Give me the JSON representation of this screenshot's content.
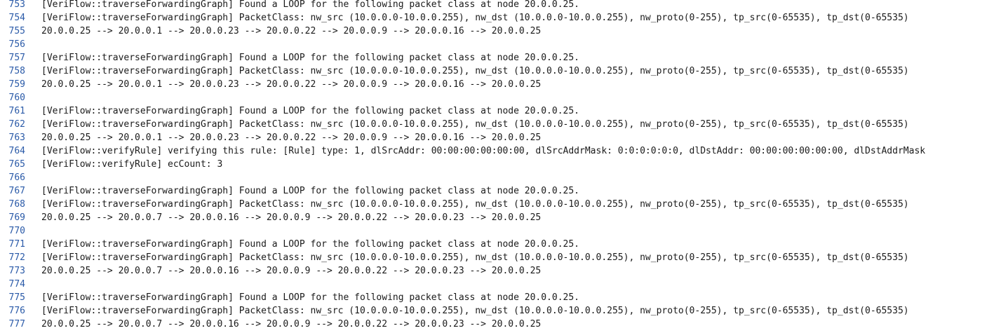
{
  "editor": {
    "lines": [
      {
        "num": "753",
        "text": "[VeriFlow::traverseForwardingGraph] Found a LOOP for the following packet class at node 20.0.0.25."
      },
      {
        "num": "754",
        "text": "[VeriFlow::traverseForwardingGraph] PacketClass: nw_src (10.0.0.0-10.0.0.255), nw_dst (10.0.0.0-10.0.0.255), nw_proto(0-255), tp_src(0-65535), tp_dst(0-65535)"
      },
      {
        "num": "755",
        "text": "20.0.0.25 --> 20.0.0.1 --> 20.0.0.23 --> 20.0.0.22 --> 20.0.0.9 --> 20.0.0.16 --> 20.0.0.25"
      },
      {
        "num": "756",
        "text": ""
      },
      {
        "num": "757",
        "text": "[VeriFlow::traverseForwardingGraph] Found a LOOP for the following packet class at node 20.0.0.25."
      },
      {
        "num": "758",
        "text": "[VeriFlow::traverseForwardingGraph] PacketClass: nw_src (10.0.0.0-10.0.0.255), nw_dst (10.0.0.0-10.0.0.255), nw_proto(0-255), tp_src(0-65535), tp_dst(0-65535)"
      },
      {
        "num": "759",
        "text": "20.0.0.25 --> 20.0.0.1 --> 20.0.0.23 --> 20.0.0.22 --> 20.0.0.9 --> 20.0.0.16 --> 20.0.0.25"
      },
      {
        "num": "760",
        "text": ""
      },
      {
        "num": "761",
        "text": "[VeriFlow::traverseForwardingGraph] Found a LOOP for the following packet class at node 20.0.0.25."
      },
      {
        "num": "762",
        "text": "[VeriFlow::traverseForwardingGraph] PacketClass: nw_src (10.0.0.0-10.0.0.255), nw_dst (10.0.0.0-10.0.0.255), nw_proto(0-255), tp_src(0-65535), tp_dst(0-65535)"
      },
      {
        "num": "763",
        "text": "20.0.0.25 --> 20.0.0.1 --> 20.0.0.23 --> 20.0.0.22 --> 20.0.0.9 --> 20.0.0.16 --> 20.0.0.25"
      },
      {
        "num": "764",
        "text": "[VeriFlow::verifyRule] verifying this rule: [Rule] type: 1, dlSrcAddr: 00:00:00:00:00:00, dlSrcAddrMask: 0:0:0:0:0:0, dlDstAddr: 00:00:00:00:00:00, dlDstAddrMask"
      },
      {
        "num": "765",
        "text": "[VeriFlow::verifyRule] ecCount: 3"
      },
      {
        "num": "766",
        "text": ""
      },
      {
        "num": "767",
        "text": "[VeriFlow::traverseForwardingGraph] Found a LOOP for the following packet class at node 20.0.0.25."
      },
      {
        "num": "768",
        "text": "[VeriFlow::traverseForwardingGraph] PacketClass: nw_src (10.0.0.0-10.0.0.255), nw_dst (10.0.0.0-10.0.0.255), nw_proto(0-255), tp_src(0-65535), tp_dst(0-65535)"
      },
      {
        "num": "769",
        "text": "20.0.0.25 --> 20.0.0.7 --> 20.0.0.16 --> 20.0.0.9 --> 20.0.0.22 --> 20.0.0.23 --> 20.0.0.25"
      },
      {
        "num": "770",
        "text": ""
      },
      {
        "num": "771",
        "text": "[VeriFlow::traverseForwardingGraph] Found a LOOP for the following packet class at node 20.0.0.25."
      },
      {
        "num": "772",
        "text": "[VeriFlow::traverseForwardingGraph] PacketClass: nw_src (10.0.0.0-10.0.0.255), nw_dst (10.0.0.0-10.0.0.255), nw_proto(0-255), tp_src(0-65535), tp_dst(0-65535)"
      },
      {
        "num": "773",
        "text": "20.0.0.25 --> 20.0.0.7 --> 20.0.0.16 --> 20.0.0.9 --> 20.0.0.22 --> 20.0.0.23 --> 20.0.0.25"
      },
      {
        "num": "774",
        "text": ""
      },
      {
        "num": "775",
        "text": "[VeriFlow::traverseForwardingGraph] Found a LOOP for the following packet class at node 20.0.0.25."
      },
      {
        "num": "776",
        "text": "[VeriFlow::traverseForwardingGraph] PacketClass: nw_src (10.0.0.0-10.0.0.255), nw_dst (10.0.0.0-10.0.0.255), nw_proto(0-255), tp_src(0-65535), tp_dst(0-65535)"
      },
      {
        "num": "777",
        "text": "20.0.0.25 --> 20.0.0.7 --> 20.0.0.16 --> 20.0.0.9 --> 20.0.0.22 --> 20.0.0.23 --> 20.0.0.25"
      }
    ]
  }
}
